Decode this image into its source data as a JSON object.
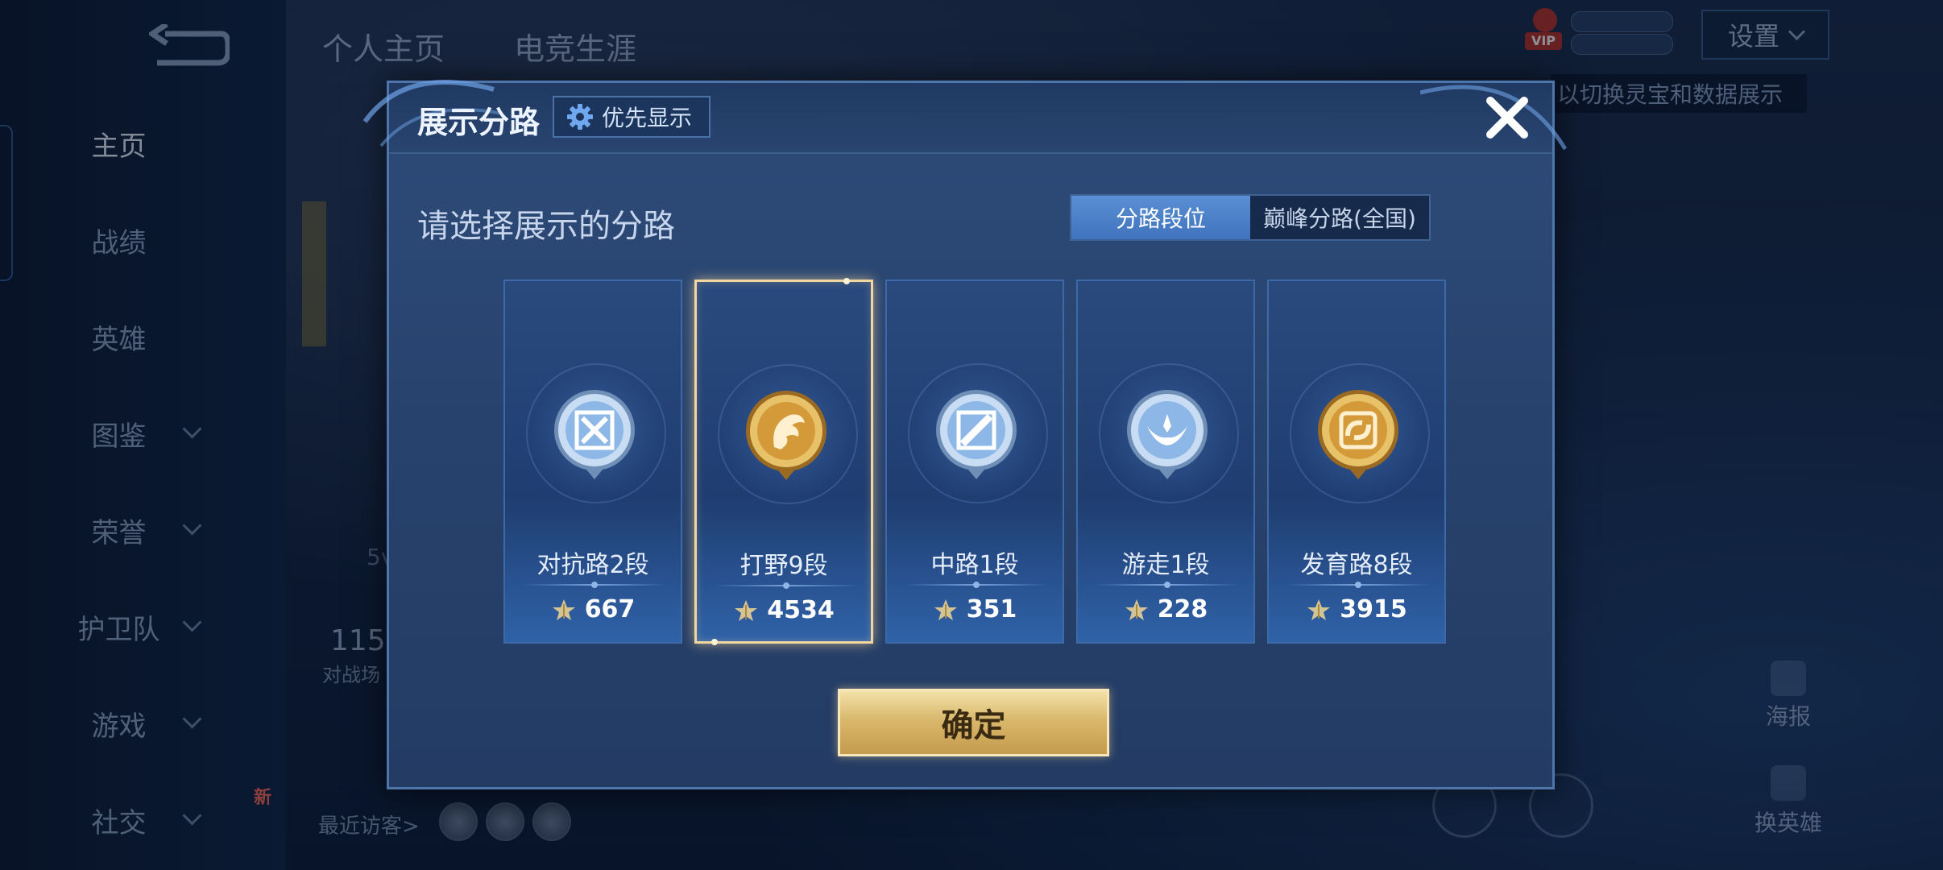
{
  "sidebar": {
    "items": [
      {
        "label": "主页",
        "active": true,
        "has_chevron": false
      },
      {
        "label": "战绩",
        "active": false,
        "has_chevron": false
      },
      {
        "label": "英雄",
        "active": false,
        "has_chevron": false
      },
      {
        "label": "图鉴",
        "active": false,
        "has_chevron": true
      },
      {
        "label": "荣誉",
        "active": false,
        "has_chevron": true
      },
      {
        "label": "护卫队",
        "active": false,
        "has_chevron": true
      },
      {
        "label": "游戏",
        "active": false,
        "has_chevron": true
      },
      {
        "label": "社交",
        "active": false,
        "has_chevron": true
      }
    ],
    "social_badge": "新"
  },
  "top_tabs": [
    "个人主页",
    "电竞生涯"
  ],
  "header_right": {
    "settings_label": "设置",
    "vip_label": "VIP",
    "tip_text": "以切换灵宝和数据展示"
  },
  "background": {
    "recent_visitors_label": "最近访客>",
    "stat_number": "115",
    "stat_label": "对战场",
    "mode_label": "5v",
    "poster_label": "海报",
    "switch_hero_label": "换英雄"
  },
  "modal": {
    "title": "展示分路",
    "priority_label": "优先显示",
    "subtitle": "请选择展示的分路",
    "segments": [
      {
        "label": "分路段位",
        "active": true
      },
      {
        "label": "巅峰分路(全国)",
        "active": false
      }
    ],
    "lanes": [
      {
        "name": "对抗路2段",
        "points": "667",
        "emblem": "clash-lane-emblem-icon",
        "tier": "silver",
        "selected": false
      },
      {
        "name": "打野9段",
        "points": "4534",
        "emblem": "jungle-emblem-icon",
        "tier": "gold",
        "selected": true
      },
      {
        "name": "中路1段",
        "points": "351",
        "emblem": "mid-lane-emblem-icon",
        "tier": "silver",
        "selected": false
      },
      {
        "name": "游走1段",
        "points": "228",
        "emblem": "roam-emblem-icon",
        "tier": "silver",
        "selected": false
      },
      {
        "name": "发育路8段",
        "points": "3915",
        "emblem": "farm-lane-emblem-icon",
        "tier": "gold",
        "selected": false
      }
    ],
    "confirm_label": "确定"
  },
  "colors": {
    "accent_gold": "#d9b86d",
    "accent_blue": "#4a80c8",
    "modal_bg": "#2b4674"
  }
}
